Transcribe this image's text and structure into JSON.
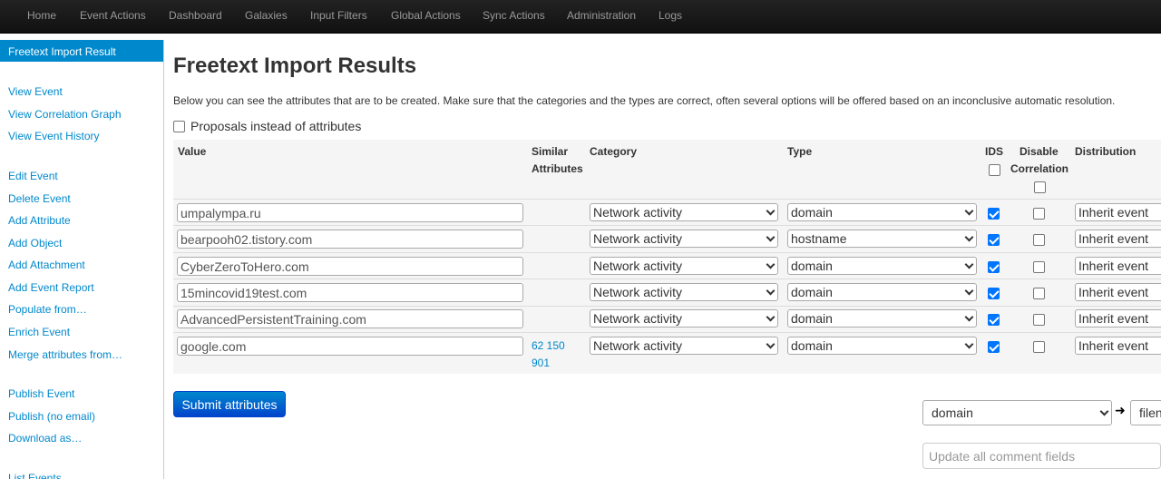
{
  "nav": [
    "Home",
    "Event Actions",
    "Dashboard",
    "Galaxies",
    "Input Filters",
    "Global Actions",
    "Sync Actions",
    "Administration",
    "Logs"
  ],
  "sidebar": {
    "active": "Freetext Import Result",
    "links": [
      "View Event",
      "View Correlation Graph",
      "View Event History",
      "Edit Event",
      "Delete Event",
      "Add Attribute",
      "Add Object",
      "Add Attachment",
      "Add Event Report",
      "Populate from…",
      "Enrich Event",
      "Merge attributes from…",
      "Publish Event",
      "Publish (no email)",
      "Download as…",
      "List Events"
    ]
  },
  "page": {
    "title": "Freetext Import Results",
    "description": "Below you can see the attributes that are to be created. Make sure that the categories and the types are correct, often several options will be offered based on an inconclusive automatic resolution.",
    "proposals_label": "Proposals instead of attributes"
  },
  "table": {
    "headers": {
      "value": "Value",
      "similar_1": "Similar",
      "similar_2": "Attributes",
      "category": "Category",
      "type": "Type",
      "ids": "IDS",
      "disable_1": "Disable",
      "disable_2": "Correlation",
      "distribution": "Distribution"
    },
    "rows": [
      {
        "value": "umpalympa.ru",
        "category": "Network activity",
        "type": "domain",
        "ids": true,
        "disable_correlation": false,
        "distribution": "Inherit event"
      },
      {
        "value": "bearpooh02.tistory.com",
        "category": "Network activity",
        "type": "hostname",
        "ids": true,
        "disable_correlation": false,
        "distribution": "Inherit event"
      },
      {
        "value": "CyberZeroToHero.com",
        "category": "Network activity",
        "type": "domain",
        "ids": true,
        "disable_correlation": false,
        "distribution": "Inherit event"
      },
      {
        "value": "15mincovid19test.com",
        "category": "Network activity",
        "type": "domain",
        "ids": true,
        "disable_correlation": false,
        "distribution": "Inherit event"
      },
      {
        "value": "AdvancedPersistentTraining.com",
        "category": "Network activity",
        "type": "domain",
        "ids": true,
        "disable_correlation": false,
        "distribution": "Inherit event"
      },
      {
        "value": "google.com",
        "category": "Network activity",
        "type": "domain",
        "ids": true,
        "disable_correlation": false,
        "distribution": "Inherit event"
      }
    ],
    "similar_attributes": "62 150 901"
  },
  "actions": {
    "submit_label": "Submit attributes",
    "bulk_type": "domain",
    "bulk_target": "filen",
    "comment_placeholder": "Update all comment fields"
  }
}
